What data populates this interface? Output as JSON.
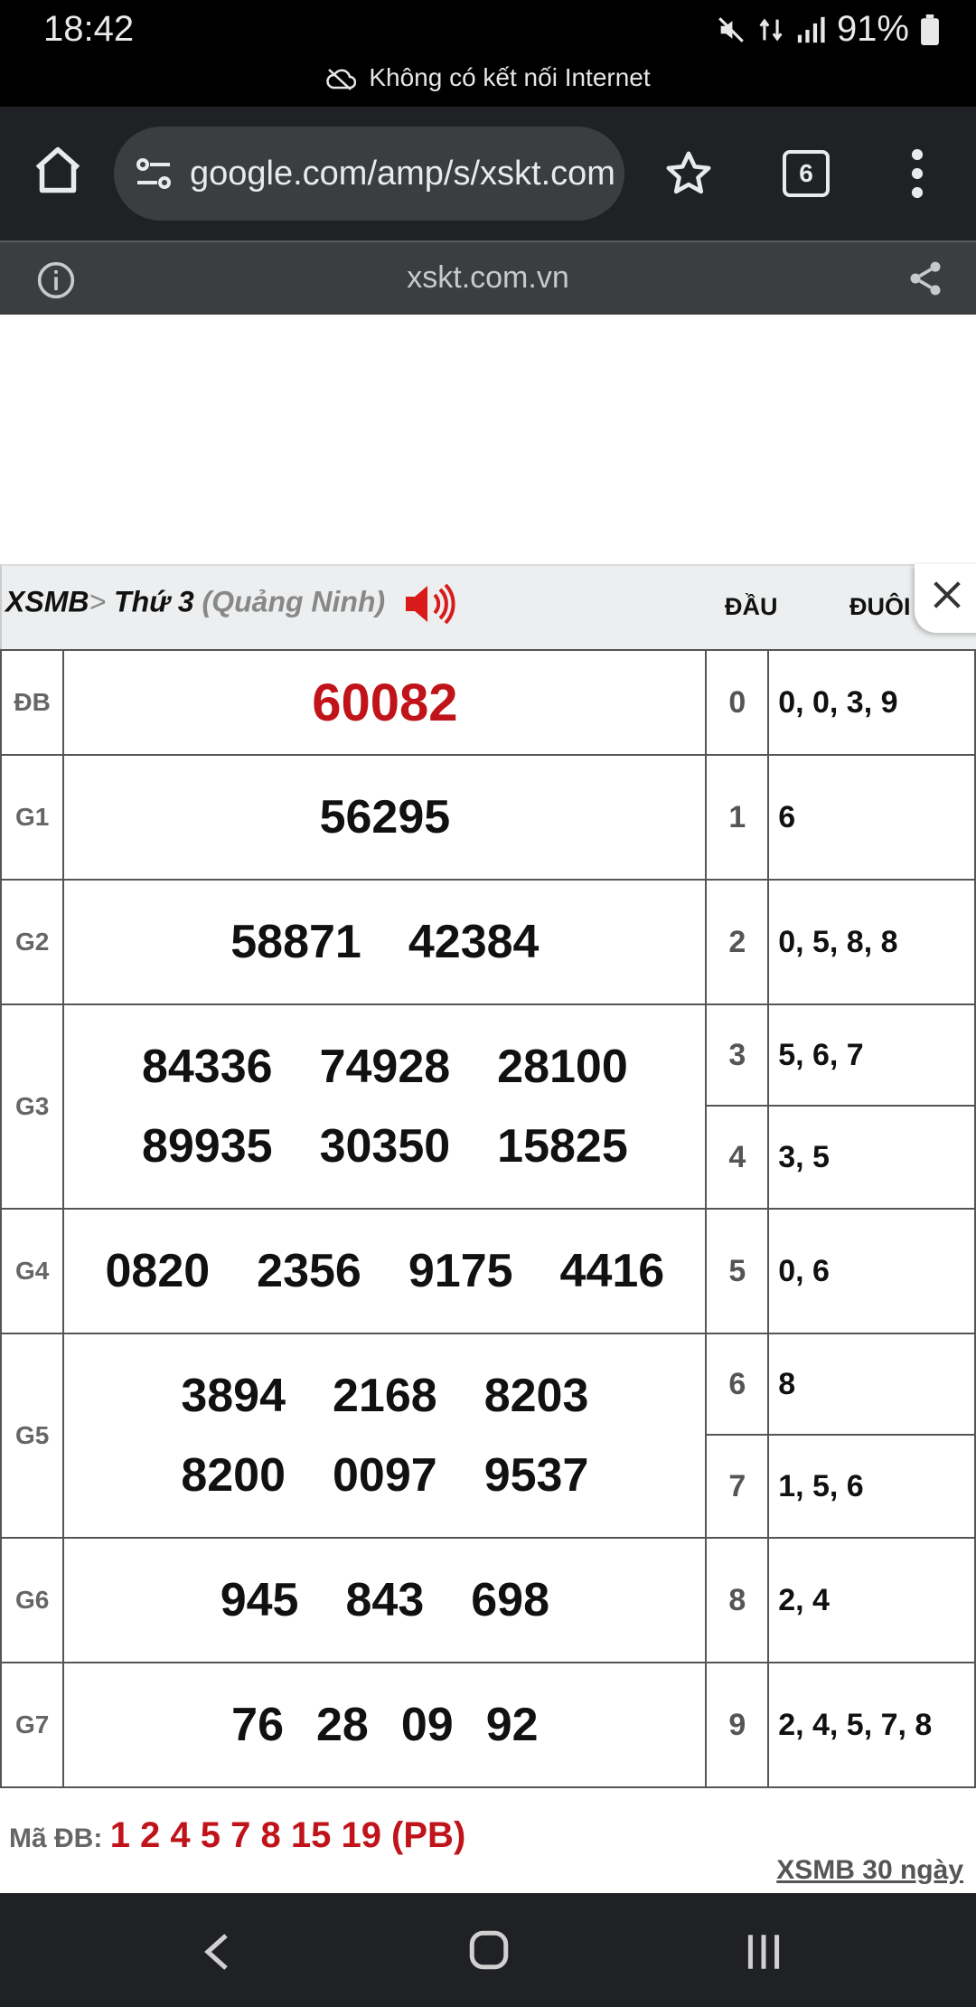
{
  "status": {
    "time": "18:42",
    "battery": "91%",
    "offline_text": "Không có kết nối Internet"
  },
  "browser": {
    "url": "google.com/amp/s/xskt.com.vn",
    "tab_count": "6",
    "amp_domain": "xskt.com.vn"
  },
  "results": {
    "title_main": "XSMB",
    "title_sep": ">",
    "title_day": "Thứ 3",
    "title_province": "(Quảng Ninh)",
    "col_head": "ĐẦU",
    "col_tail": "ĐUÔI",
    "prizes": [
      {
        "label": "ĐB",
        "lines": [
          [
            "60082"
          ]
        ]
      },
      {
        "label": "G1",
        "lines": [
          [
            "56295"
          ]
        ]
      },
      {
        "label": "G2",
        "lines": [
          [
            "58871",
            "42384"
          ]
        ]
      },
      {
        "label": "G3",
        "lines": [
          [
            "84336",
            "74928",
            "28100"
          ],
          [
            "89935",
            "30350",
            "15825"
          ]
        ]
      },
      {
        "label": "G4",
        "lines": [
          [
            "0820",
            "2356",
            "9175",
            "4416"
          ]
        ]
      },
      {
        "label": "G5",
        "lines": [
          [
            "3894",
            "2168",
            "8203"
          ],
          [
            "8200",
            "0097",
            "9537"
          ]
        ]
      },
      {
        "label": "G6",
        "lines": [
          [
            "945",
            "843",
            "698"
          ]
        ]
      },
      {
        "label": "G7",
        "lines": [
          [
            "76",
            "28",
            "09",
            "92"
          ]
        ]
      }
    ],
    "loto": [
      {
        "head": "0",
        "tail": "0, 0, 3, 9"
      },
      {
        "head": "1",
        "tail": "6"
      },
      {
        "head": "2",
        "tail": "0, 5, 8, 8"
      },
      {
        "head": "3",
        "tail": "5, 6, 7"
      },
      {
        "head": "4",
        "tail": "3, 5"
      },
      {
        "head": "5",
        "tail": "0, 6"
      },
      {
        "head": "6",
        "tail": "8"
      },
      {
        "head": "7",
        "tail": "1, 5, 6"
      },
      {
        "head": "8",
        "tail": "2, 4"
      },
      {
        "head": "9",
        "tail": "2, 4, 5, 7, 8"
      }
    ],
    "ma_db_label": "Mã ĐB:",
    "ma_db_codes": "1 2 4 5 7 8 15 19 (PB)",
    "link_30_days": "XSMB 30 ngày"
  },
  "colors": {
    "special_prize": "#c0141a",
    "toolbar_bg": "#202124"
  }
}
